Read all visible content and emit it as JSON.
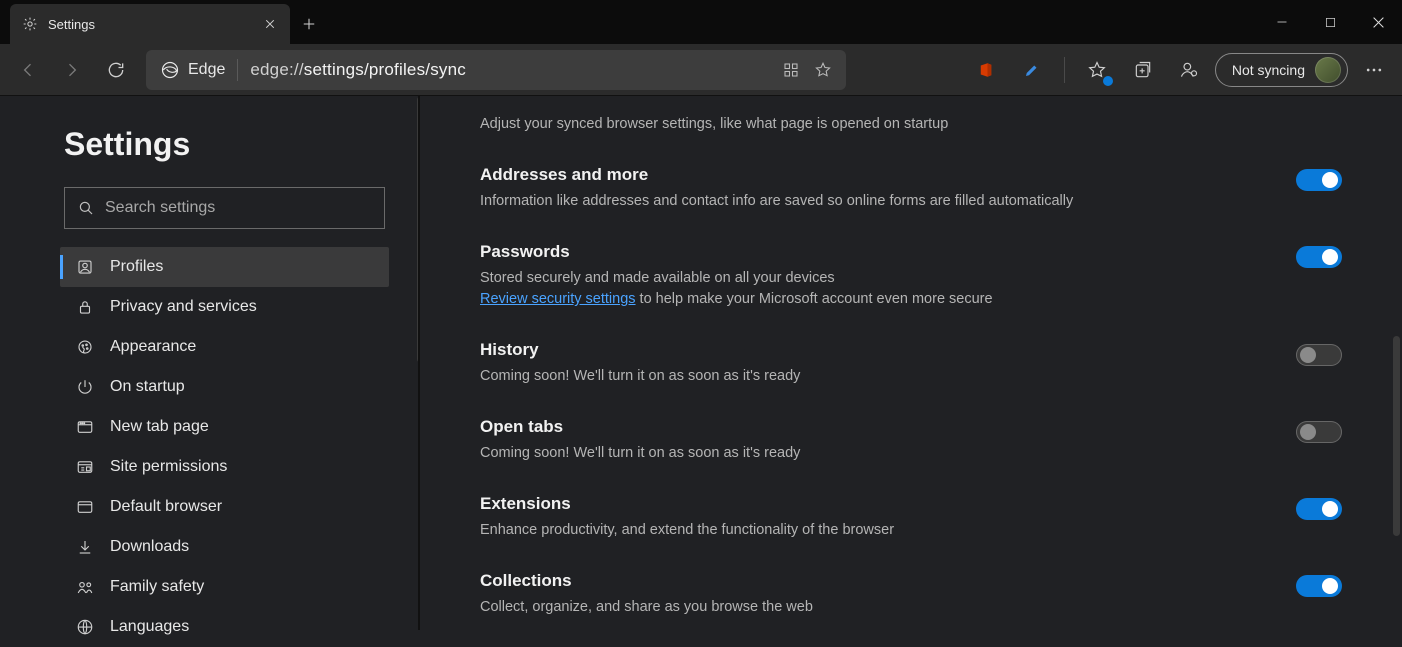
{
  "titlebar": {
    "tab_title": "Settings"
  },
  "toolbar": {
    "brand_label": "Edge",
    "url_prefix": "edge://",
    "url_path": "settings/profiles/sync",
    "sync_pill_label": "Not syncing"
  },
  "sidebar": {
    "heading": "Settings",
    "search": {
      "placeholder": "Search settings"
    },
    "items": [
      {
        "label": "Profiles",
        "icon": "profile-icon",
        "active": true
      },
      {
        "label": "Privacy and services",
        "icon": "lock-icon"
      },
      {
        "label": "Appearance",
        "icon": "appearance-icon"
      },
      {
        "label": "On startup",
        "icon": "power-icon"
      },
      {
        "label": "New tab page",
        "icon": "newtab-icon"
      },
      {
        "label": "Site permissions",
        "icon": "permissions-icon"
      },
      {
        "label": "Default browser",
        "icon": "browser-icon"
      },
      {
        "label": "Downloads",
        "icon": "download-icon"
      },
      {
        "label": "Family safety",
        "icon": "family-icon"
      },
      {
        "label": "Languages",
        "icon": "language-icon"
      }
    ]
  },
  "content": {
    "settings": [
      {
        "title": "",
        "sub": "Adjust your synced browser settings, like what page is opened on startup",
        "toggle": "hidden"
      },
      {
        "title": "Addresses and more",
        "sub": "Information like addresses and contact info are saved so online forms are filled automatically",
        "toggle": "on"
      },
      {
        "title": "Passwords",
        "sub": "Stored securely and made available on all your devices",
        "link_text": "Review security settings",
        "link_tail": " to help make your Microsoft account even more secure",
        "toggle": "on"
      },
      {
        "title": "History",
        "sub": "Coming soon! We'll turn it on as soon as it's ready",
        "toggle": "off"
      },
      {
        "title": "Open tabs",
        "sub": "Coming soon! We'll turn it on as soon as it's ready",
        "toggle": "off"
      },
      {
        "title": "Extensions",
        "sub": "Enhance productivity, and extend the functionality of the browser",
        "toggle": "on"
      },
      {
        "title": "Collections",
        "sub": "Collect, organize, and share as you browse the web",
        "toggle": "on"
      }
    ]
  }
}
